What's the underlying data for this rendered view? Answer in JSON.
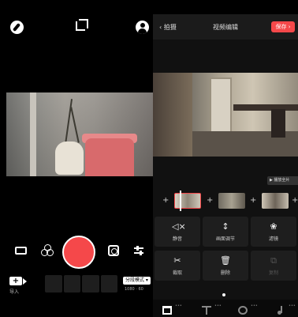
{
  "camera": {
    "bottom": {
      "import_label": "导入",
      "mode_label": "分段模式 ▾",
      "resolution": "1080 · 60"
    }
  },
  "editor": {
    "header": {
      "back_label": "‹ 拍摄",
      "title": "视频编辑",
      "save_label": "保存 ›"
    },
    "play_full_label": "▶ 播放全片",
    "timeline": {
      "add_symbol": "+"
    },
    "tools": [
      {
        "icon": "mute-icon",
        "glyph": "◁×",
        "label": "静音",
        "enabled": true
      },
      {
        "icon": "adjust-icon",
        "glyph": "↕",
        "label": "画面调节",
        "enabled": true
      },
      {
        "icon": "filter-icon",
        "glyph": "❀",
        "label": "滤镜",
        "enabled": true
      },
      {
        "icon": "scissors-icon",
        "glyph": "✂",
        "label": "裁取",
        "enabled": true
      },
      {
        "icon": "trash-icon",
        "glyph": "🗑",
        "label": "删除",
        "enabled": true
      },
      {
        "icon": "copy-icon",
        "glyph": "⧉",
        "label": "复制",
        "enabled": false
      }
    ],
    "tabbar": {
      "dots": "•••"
    }
  },
  "colors": {
    "accent": "#f5484a",
    "panel": "#1e1e1e",
    "background": "#000000"
  }
}
